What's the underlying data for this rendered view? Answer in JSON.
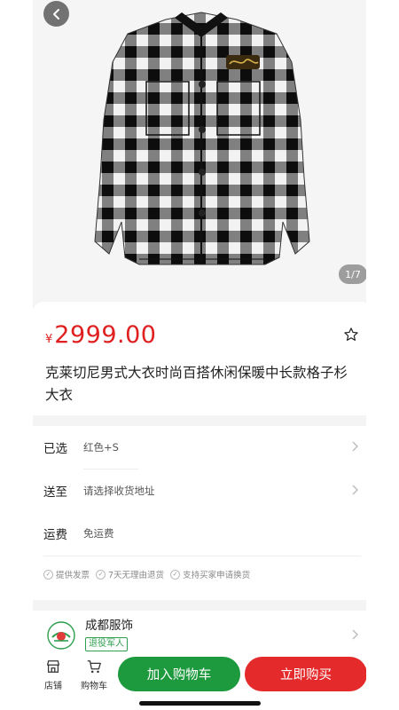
{
  "hero": {
    "counter": "1/7"
  },
  "product": {
    "currency": "¥",
    "price": "2999.00",
    "title_line1": "克莱切尼男式大衣时尚百搭休闲保暖中长款格子杉",
    "title_line2": "大衣"
  },
  "options": [
    {
      "label": "已选",
      "value": "红色+S"
    },
    {
      "label": "送至",
      "value": "请选择收货地址"
    },
    {
      "label": "运费",
      "value": "免运费"
    }
  ],
  "promises": [
    "提供发票",
    "7天无理由退货",
    "支持买家申请换货"
  ],
  "shop": {
    "name": "成都服饰",
    "badge": "退役军人"
  },
  "bottom": {
    "store_label": "店铺",
    "cart_label": "购物车",
    "add_to_cart": "加入购物车",
    "buy_now": "立即购买"
  },
  "colors": {
    "price_red": "#e02020",
    "cart_green": "#1e9a3e",
    "buy_red": "#e42a2a"
  }
}
